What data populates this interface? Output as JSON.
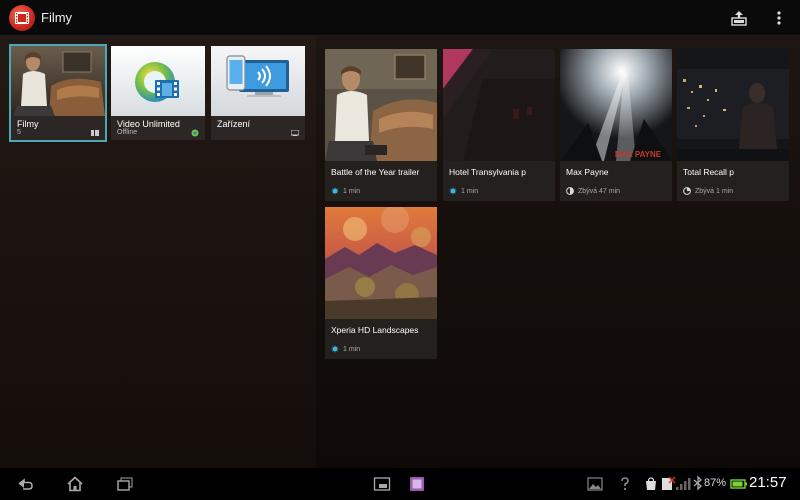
{
  "actionbar": {
    "title": "Filmy",
    "icons": [
      "film-reel-icon",
      "share-upload-icon",
      "overflow-menu-icon"
    ]
  },
  "sources": [
    {
      "label": "Filmy",
      "sublabel": "5",
      "selected": true
    },
    {
      "label": "Video Unlimited",
      "sublabel": "Offline",
      "selected": false
    },
    {
      "label": "Zařízení",
      "sublabel": "",
      "selected": false
    }
  ],
  "movies": [
    {
      "title": "Battle of the Year trailer",
      "meta": "1 min",
      "status_icon": "new-star-icon"
    },
    {
      "title": "Hotel Transylvania p",
      "meta": "1 min",
      "status_icon": "new-star-icon"
    },
    {
      "title": "Max Payne",
      "meta": "Zbývá 47 min",
      "status_icon": "progress-pie-icon",
      "poster_text": "MAX PAYNE"
    },
    {
      "title": "Total Recall p",
      "meta": "Zbývá 1 min",
      "status_icon": "progress-pie-icon"
    },
    {
      "title": "Xperia HD Landscapes",
      "meta": "1 min",
      "status_icon": "new-star-icon"
    }
  ],
  "statusbar": {
    "battery": "87%",
    "time": "21:57"
  },
  "colors": {
    "accent": "#4aa8b8",
    "new_icon": "#3ab7ea",
    "app_icon": "#c9281d"
  }
}
